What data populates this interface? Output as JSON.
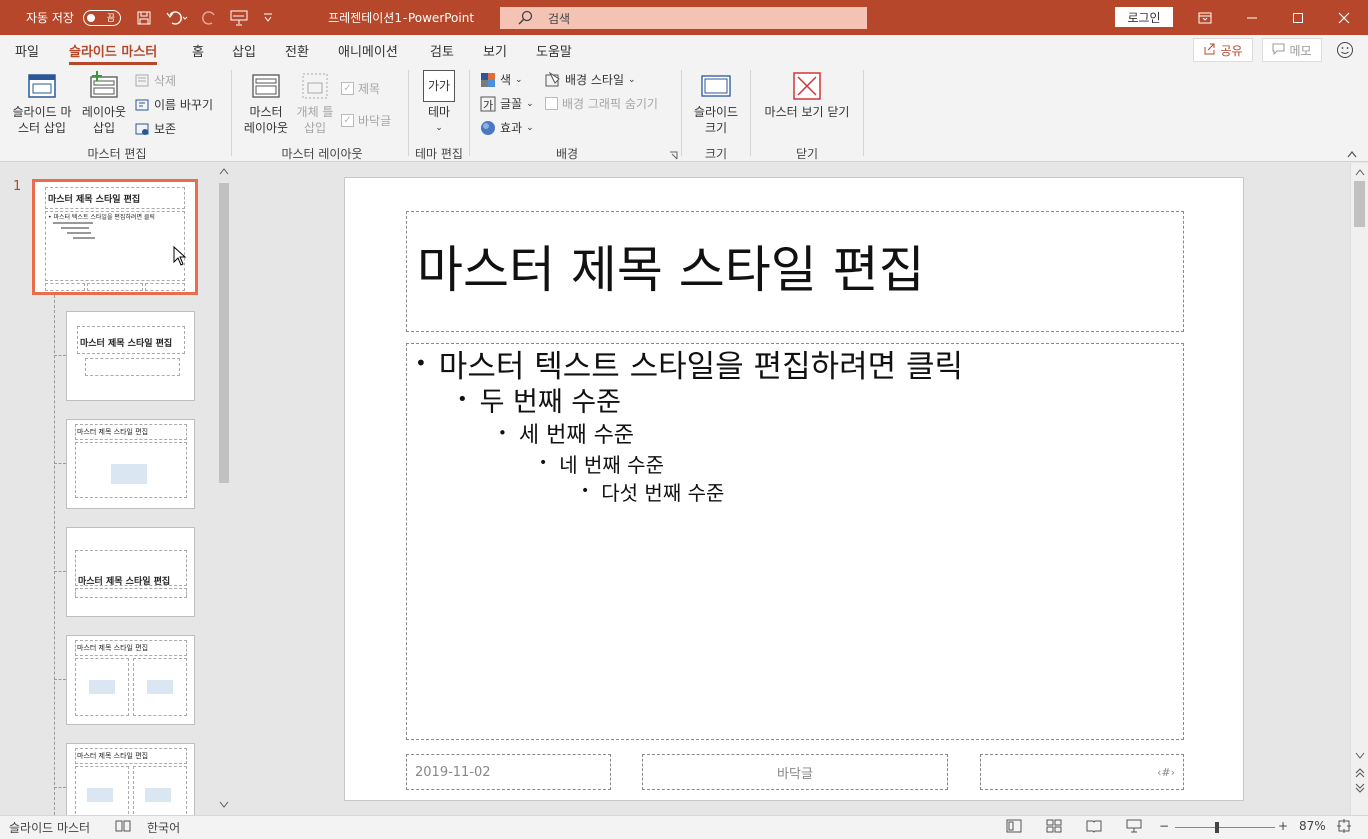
{
  "titlebar": {
    "autosave_label": "자동 저장",
    "autosave_state": "끔",
    "doc_title": "프레젠테이션1",
    "separator": "-",
    "app_name": "PowerPoint",
    "search_placeholder": "검색",
    "login_label": "로그인"
  },
  "tabs": [
    {
      "label": "파일"
    },
    {
      "label": "슬라이드 마스터"
    },
    {
      "label": "홈"
    },
    {
      "label": "삽입"
    },
    {
      "label": "전환"
    },
    {
      "label": "애니메이션"
    },
    {
      "label": "검토"
    },
    {
      "label": "보기"
    },
    {
      "label": "도움말"
    }
  ],
  "share_label": "공유",
  "memo_label": "메모",
  "ribbon": {
    "insert_master": [
      "슬라이드 마",
      "스터 삽입"
    ],
    "insert_layout": [
      "레이아웃",
      "삽입"
    ],
    "delete": "삭제",
    "rename": "이름 바꾸기",
    "preserve": "보존",
    "group_edit_master": "마스터 편집",
    "master_layout": [
      "마스터",
      "레이아웃"
    ],
    "insert_placeholder": [
      "개체 틀",
      "삽입"
    ],
    "chk_title": "제목",
    "chk_footer": "바닥글",
    "group_master_layout": "마스터 레이아웃",
    "theme": "테마",
    "theme_icon_text": "가가",
    "group_theme_edit": "테마 편집",
    "colors": "색",
    "fonts": "글꼴",
    "effects": "효과",
    "bg_styles": "배경 스타일",
    "hide_bg": "배경 그래픽 숨기기",
    "group_background": "배경",
    "slide_size": [
      "슬라이드",
      "크기"
    ],
    "group_size": "크기",
    "close_master": "마스터 보기 닫기",
    "group_close": "닫기"
  },
  "thumbs": {
    "number": "1",
    "title": "마스터 제목 스타일 편집",
    "body": "• 마스터 텍스트 스타일을 편집하려면 클릭"
  },
  "slide": {
    "title": "마스터 제목 스타일 편집",
    "bullets": [
      "마스터 텍스트 스타일을 편집하려면 클릭",
      "두 번째 수준",
      "세 번째 수준",
      "네 번째 수준",
      "다섯 번째 수준"
    ],
    "footer_date": "2019-11-02",
    "footer_center": "바닥글",
    "footer_num": "‹#›"
  },
  "status": {
    "view": "슬라이드 마스터",
    "language": "한국어",
    "zoom": "87%",
    "zoom_minus": "−",
    "zoom_plus": "+"
  },
  "colors": {
    "accent": "#b7472a",
    "selected_thumb": "#e96d4d"
  }
}
